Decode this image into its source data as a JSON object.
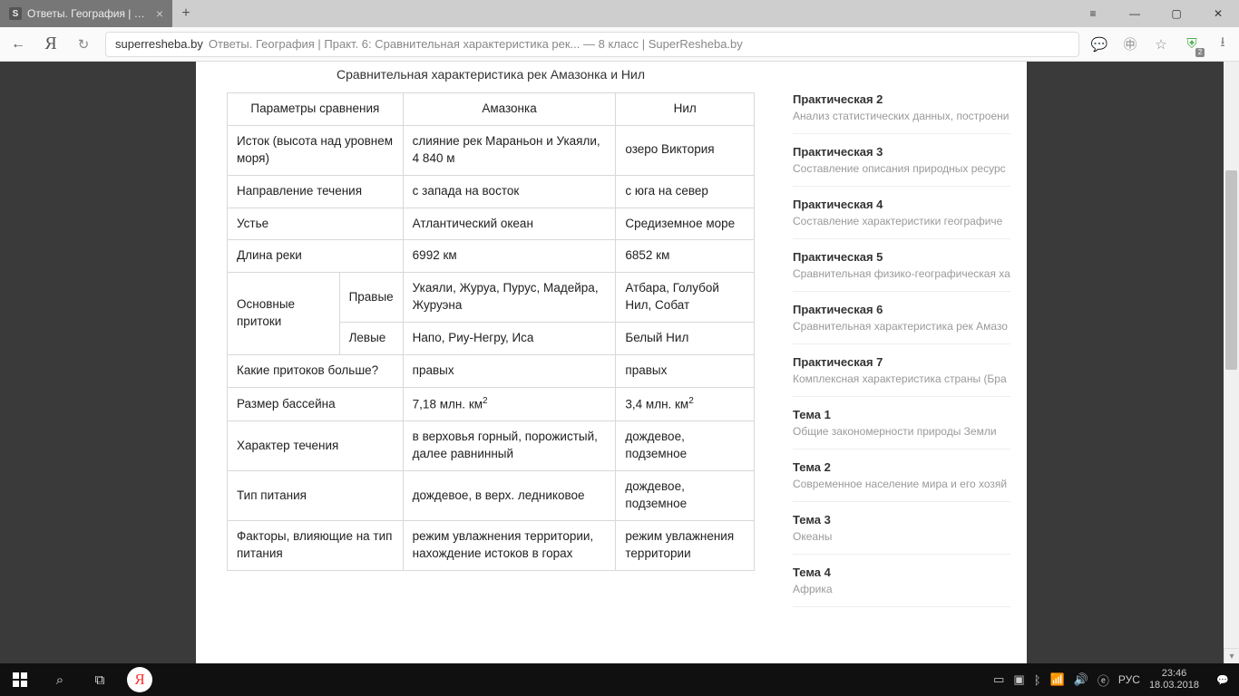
{
  "browser": {
    "tab_title": "Ответы. География | Пра",
    "domain": "superresheba.by",
    "page_title": "Ответы. География | Практ. 6: Сравнительная характеристика рек... — 8 класс | SuperResheba.by",
    "ext_badge": "2"
  },
  "content": {
    "caption": "Сравнительная характеристика рек Амазонка и Нил",
    "headers": {
      "param": "Параметры сравнения",
      "c1": "Амазонка",
      "c2": "Нил"
    },
    "rows": [
      {
        "p": "Исток (высота над уровнем моря)",
        "a": "слияние рек Мараньон и Укаяли, 4 840 м",
        "b": "озеро Виктория"
      },
      {
        "p": "Направление течения",
        "a": "с запада на восток",
        "b": "с юга на север"
      },
      {
        "p": "Устье",
        "a": "Атлантический океан",
        "b": "Средиземное море"
      },
      {
        "p": "Длина реки",
        "a": "6992 км",
        "b": "6852 км"
      }
    ],
    "tributaries": {
      "label": "Основные притоки",
      "right_label": "Правые",
      "left_label": "Левые",
      "right": {
        "a": "Укаяли, Журуа, Пурус, Мадейра, Журуэна",
        "b": "Атбара, Голубой Нил, Собат"
      },
      "left": {
        "a": "Напо, Риу-Негру, Иса",
        "b": "Белый Нил"
      }
    },
    "rows2": [
      {
        "p": "Какие притоков больше?",
        "a": "правых",
        "b": "правых"
      }
    ],
    "basin": {
      "p": "Размер бассейна",
      "a_num": "7,18 млн. км",
      "b_num": "3,4 млн. км",
      "sup": "2"
    },
    "rows3": [
      {
        "p": "Характер течения",
        "a": "в верховья горный, порожистый, далее равнинный",
        "b": "дождевое, подземное"
      },
      {
        "p": "Тип питания",
        "a": "дождевое, в верх. ледниковое",
        "b": "дождевое, подземное"
      },
      {
        "p": "Факторы, влияющие на тип питания",
        "a": "режим увлажнения территории, нахождение истоков в горах",
        "b": "режим увлажнения территории"
      }
    ]
  },
  "sidebar": [
    {
      "t": "Практическая 2",
      "s": "Анализ статистических данных, построени"
    },
    {
      "t": "Практическая 3",
      "s": "Составление описания природных ресурс"
    },
    {
      "t": "Практическая 4",
      "s": "Составление характеристики географиче"
    },
    {
      "t": "Практическая 5",
      "s": "Сравнительная физико-географическая ха"
    },
    {
      "t": "Практическая 6",
      "s": "Сравнительная характеристика рек Амазо"
    },
    {
      "t": "Практическая 7",
      "s": "Комплексная характеристика страны (Бра"
    },
    {
      "t": "Тема 1",
      "s": "Общие закономерности природы Земли"
    },
    {
      "t": "Тема 2",
      "s": "Современное население мира и его хозяй"
    },
    {
      "t": "Тема 3",
      "s": "Океаны"
    },
    {
      "t": "Тема 4",
      "s": "Африка"
    }
  ],
  "taskbar": {
    "lang": "РУС",
    "time": "23:46",
    "date": "18.03.2018"
  }
}
